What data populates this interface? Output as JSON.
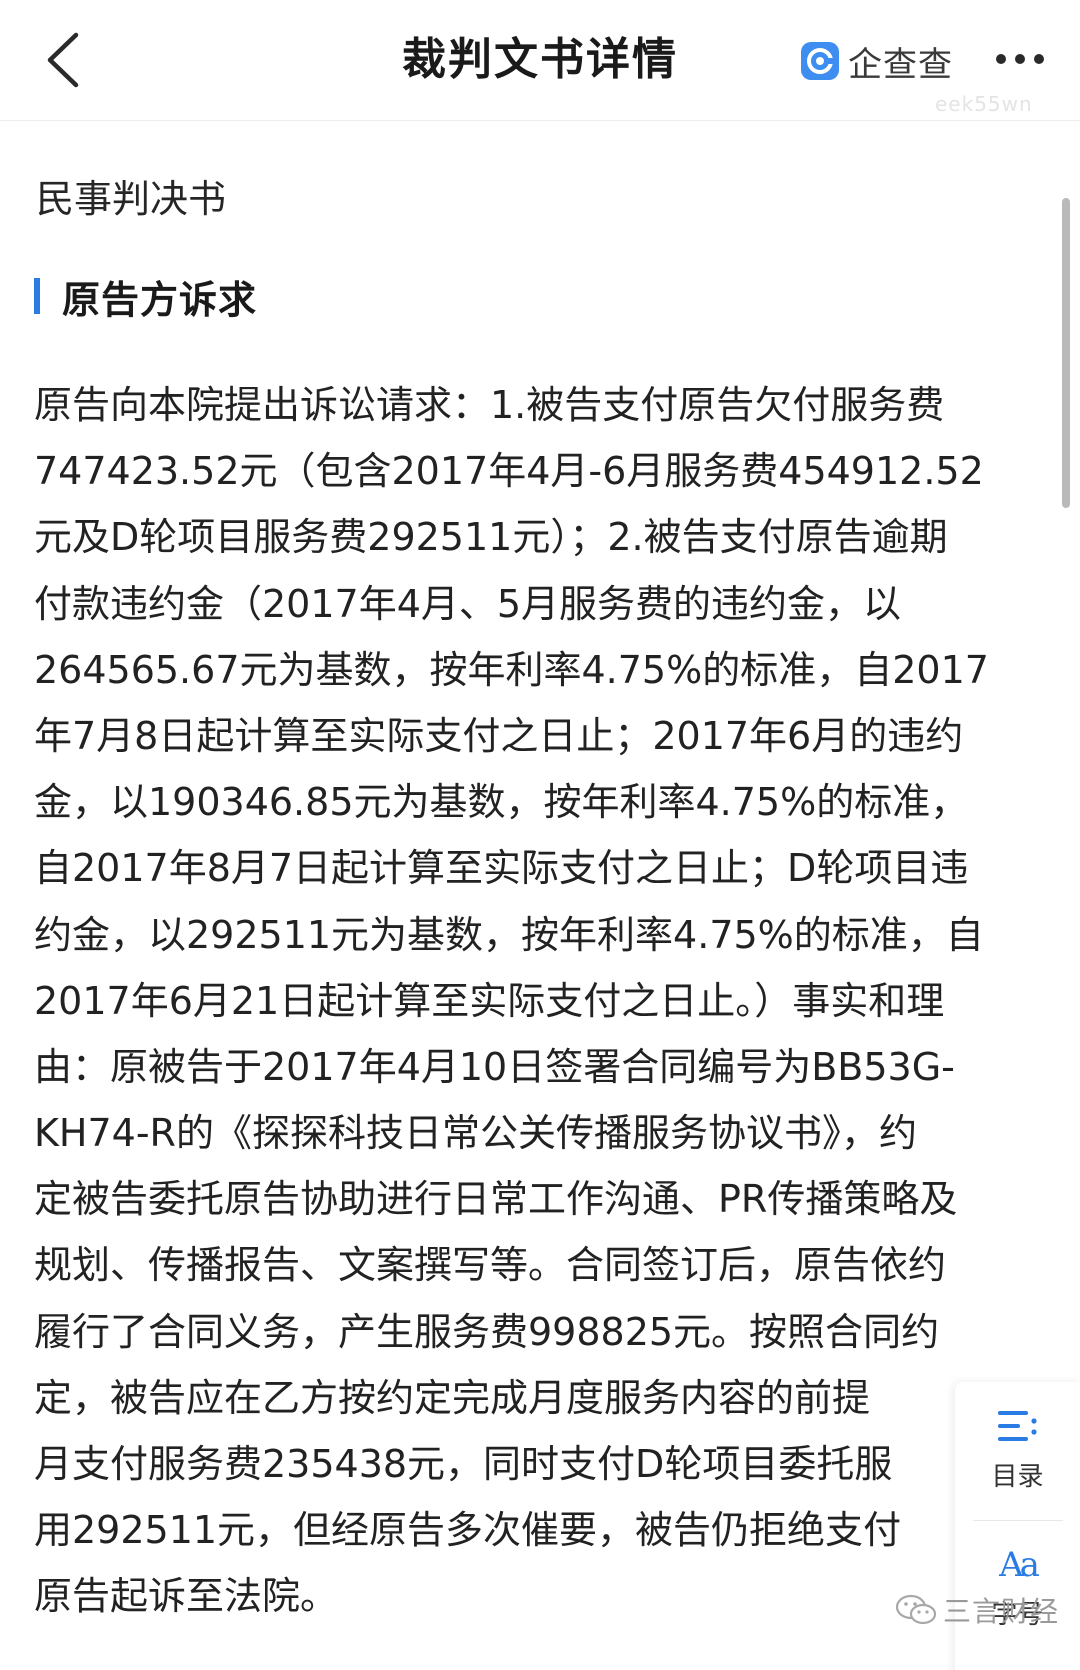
{
  "header": {
    "title": "裁判文书详情",
    "brand_name": "企查查",
    "watermark": "eek55wn"
  },
  "document": {
    "type": "民事判决书",
    "section_title": "原告方诉求",
    "lines": [
      "原告向本院提出诉讼请求：1.被告支付原告欠付服务费",
      "747423.52元（包含2017年4月-6月服务费454912.52",
      "元及D轮项目服务费292511元）；2.被告支付原告逾期",
      "付款违约金（2017年4月、5月服务费的违约金，以",
      "264565.67元为基数，按年利率4.75%的标准，自2017",
      "年7月8日起计算至实际支付之日止；2017年6月的违约",
      "金，以190346.85元为基数，按年利率4.75%的标准，",
      "自2017年8月7日起计算至实际支付之日止；D轮项目违",
      "约金，以292511元为基数，按年利率4.75%的标准，自",
      "2017年6月21日起计算至实际支付之日止。）事实和理",
      "由：原被告于2017年4月10日签署合同编号为BB53G-",
      "KH74-R的《探探科技日常公关传播服务协议书》，约",
      "定被告委托原告协助进行日常工作沟通、PR传播策略及",
      "规划、传播报告、文案撰写等。合同签订后，原告依约",
      "履行了合同义务，产生服务费998825元。按照合同约",
      "定，被告应在乙方按约定完成月度服务内容的前提",
      "月支付服务费235438元，同时支付D轮项目委托服",
      "用292511元，但经原告多次催要，被告仍拒绝支付",
      "原告起诉至法院。"
    ]
  },
  "side_panel": {
    "toc_label": "目录",
    "font_label": "字号",
    "font_icon": "Aa"
  },
  "watermark": {
    "wechat_name": "三言财经"
  },
  "colors": {
    "accent": "#2a7be4",
    "text": "#222222",
    "brand_ring": "#3d8ef0"
  }
}
